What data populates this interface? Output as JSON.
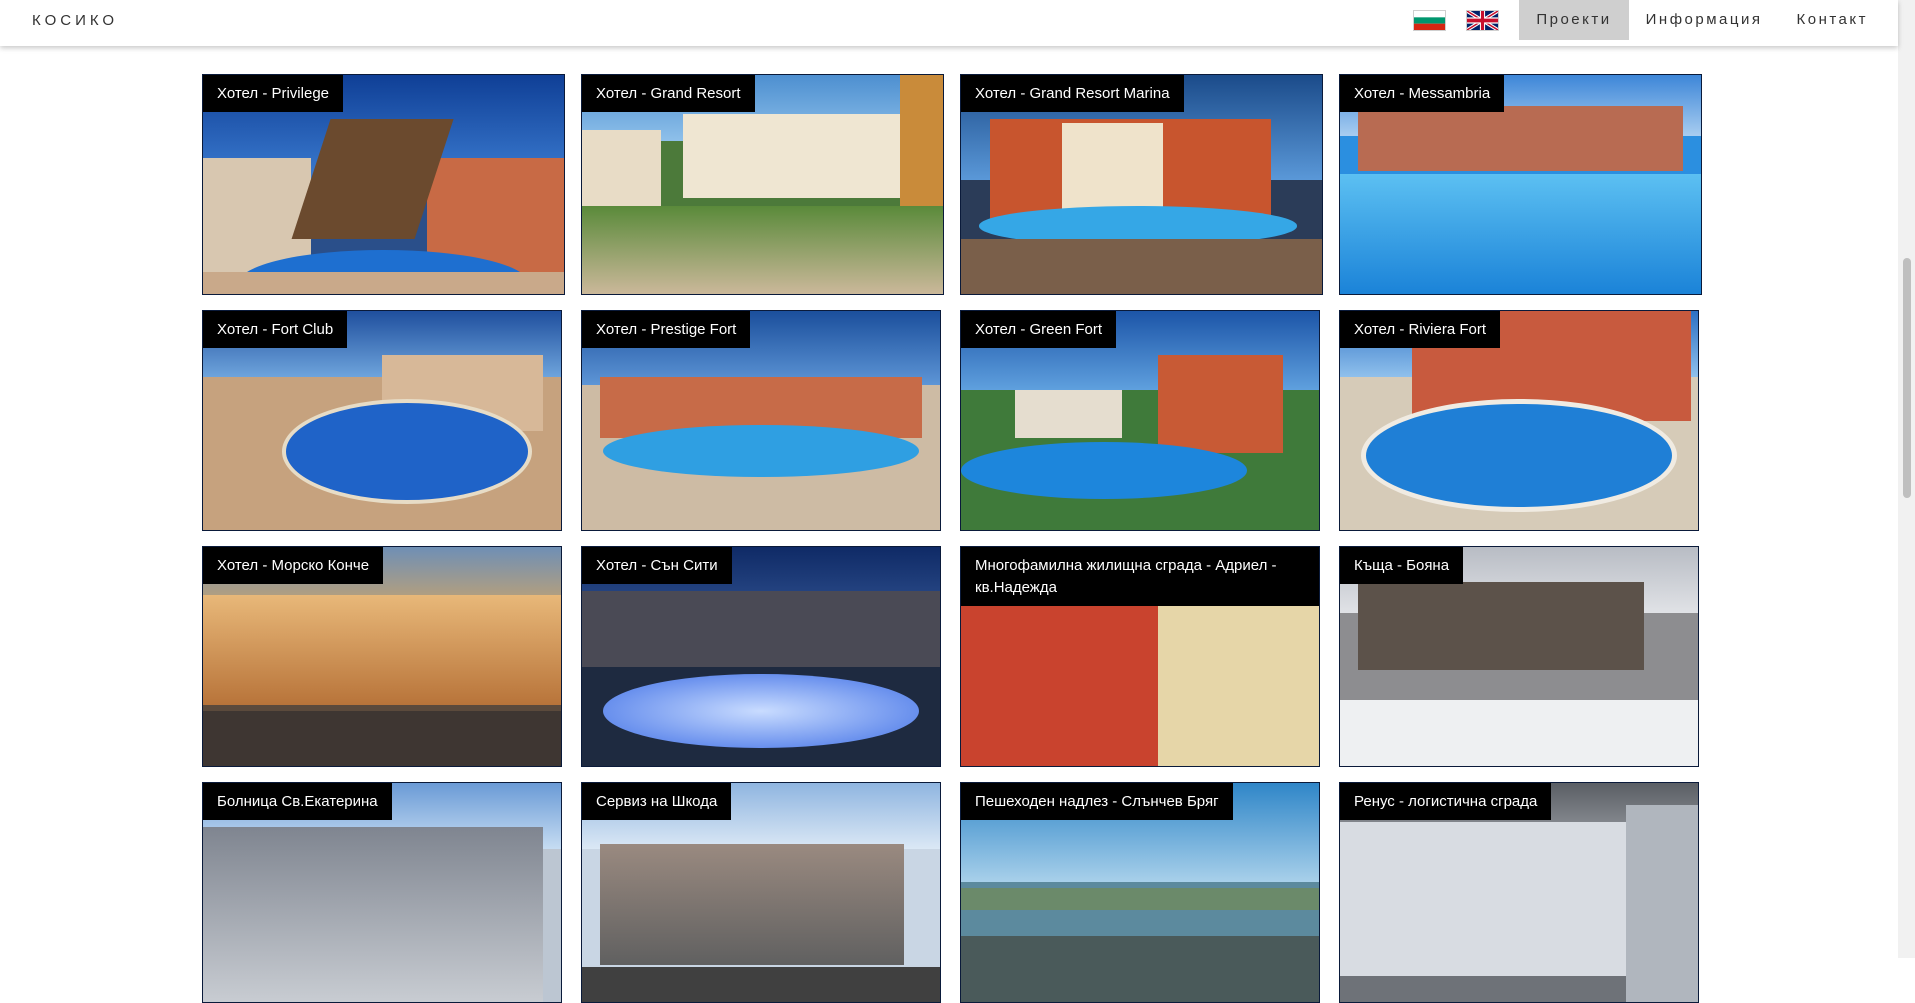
{
  "nav": {
    "brand": "КОСИКО",
    "flags": [
      {
        "name": "bulgarian-flag",
        "colors": [
          "#ffffff",
          "#00966e",
          "#d62612"
        ]
      },
      {
        "name": "english-flag",
        "colors": [
          "#012169",
          "#ffffff",
          "#c8102e"
        ]
      }
    ],
    "items": [
      {
        "label": "Проекти",
        "active": true
      },
      {
        "label": "Информация",
        "active": false
      },
      {
        "label": "Контакт",
        "active": false
      }
    ]
  },
  "projects": [
    {
      "title": "Хотел - Privilege",
      "scene": "hotel-pool-ship"
    },
    {
      "title": "Хотел - Grand Resort",
      "scene": "hotel-path"
    },
    {
      "title": "Хотел - Grand Resort Marina",
      "scene": "hotel-pool-dusk"
    },
    {
      "title": "Хотел - Messambria",
      "scene": "hotel-pool-bright"
    },
    {
      "title": "Хотел - Fort Club",
      "scene": "hotel-pool-round"
    },
    {
      "title": "Хотел - Prestige Fort",
      "scene": "hotel-pool-oval"
    },
    {
      "title": "Хотел - Green Fort",
      "scene": "hotel-pool-garden"
    },
    {
      "title": "Хотел - Riviera Fort",
      "scene": "hotel-pool-round"
    },
    {
      "title": "Хотел - Морско Кончe",
      "scene": "hotel-sunset"
    },
    {
      "title": "Хотел - Сън Сити",
      "scene": "hotel-night-pool"
    },
    {
      "title": "Многофамилна жилищна сграда - Адриел - кв.Надежда",
      "scene": "residential-red"
    },
    {
      "title": "Къща - Бояна",
      "scene": "house-snow"
    },
    {
      "title": "Болница Св.Екатерина",
      "scene": "hospital"
    },
    {
      "title": "Сервиз на Шкода",
      "scene": "car-service"
    },
    {
      "title": "Пешеходен надлез - Слънчев Бряг",
      "scene": "pedestrian-bridge"
    },
    {
      "title": "Ренус - логистична сграда",
      "scene": "logistics"
    }
  ]
}
